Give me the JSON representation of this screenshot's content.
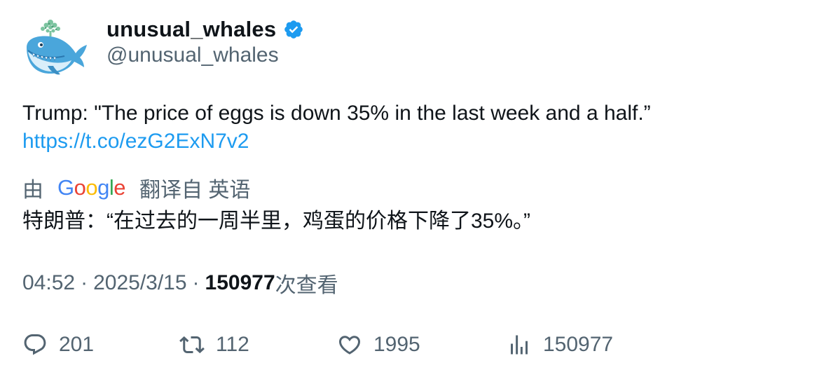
{
  "user": {
    "display_name": "unusual_whales",
    "handle": "@unusual_whales",
    "verified": true
  },
  "tweet": {
    "text": "Trump: \"The price of eggs is down 35% in the last week and a half.”",
    "link": "https://t.co/ezG2ExN7v2"
  },
  "translation": {
    "prefix": "由",
    "provider": "Google",
    "suffix": "翻译自 英语",
    "text": "特朗普：“在过去的一周半里，鸡蛋的价格下降了35%。”"
  },
  "meta": {
    "time": "04:52",
    "separator": "·",
    "date": "2025/3/15",
    "views_count": "150977",
    "views_label": "次查看"
  },
  "actions": {
    "replies": "201",
    "retweets": "112",
    "likes": "1995",
    "views": "150977"
  },
  "colors": {
    "text_primary": "#0f1419",
    "text_secondary": "#536471",
    "link": "#1d9bf0",
    "verified": "#1d9bf0"
  }
}
